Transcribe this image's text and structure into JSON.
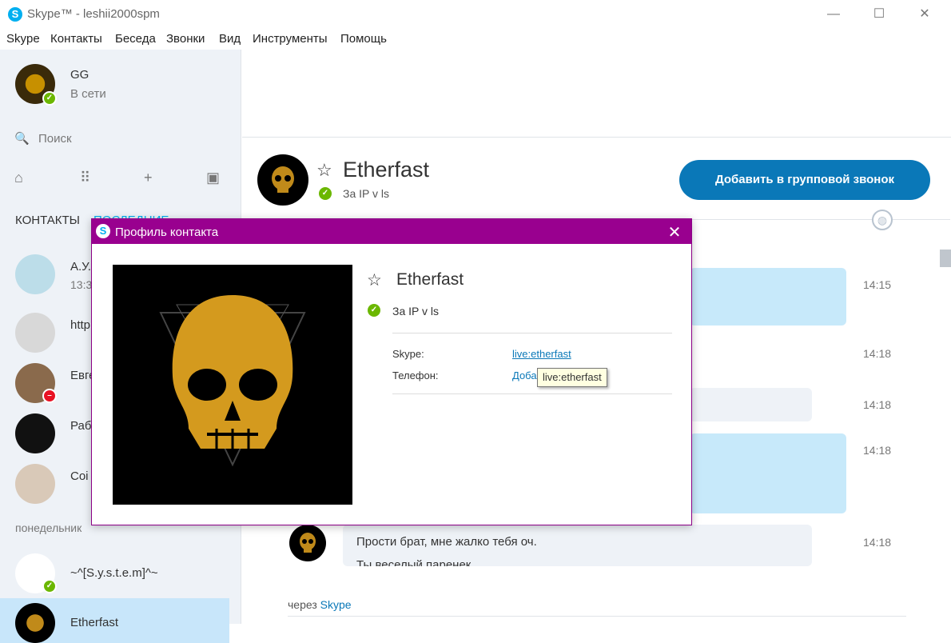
{
  "window": {
    "title": "Skype™ - leshii2000spm",
    "minimize": "—",
    "maximize": "☐",
    "close": "✕"
  },
  "menu": [
    "Skype",
    "Контакты",
    "Беседа",
    "Звонки",
    "Вид",
    "Инструменты",
    "Помощь"
  ],
  "me": {
    "name": "GG",
    "status": "В сети"
  },
  "search": {
    "placeholder": "Поиск"
  },
  "tabs": {
    "contacts": "КОНТАКТЫ",
    "recent": "ПОСЛЕДНИЕ"
  },
  "contacts": [
    {
      "name": "А.У.",
      "sub": "13:3"
    },
    {
      "name": "http",
      "sub": ""
    },
    {
      "name": "Евге",
      "sub": ""
    },
    {
      "name": "Раб",
      "sub": ""
    },
    {
      "name": "Coi",
      "sub": ""
    }
  ],
  "day_label": "понедельник",
  "contacts2": [
    {
      "name": "~^[S.y.s.t.e.m]^~"
    },
    {
      "name": "Etherfast"
    }
  ],
  "chat": {
    "name": "Etherfast",
    "status": "За IP v ls",
    "group_call_label": "Добавить в групповой звонок",
    "times": [
      "14:15",
      "14:18",
      "14:18",
      "14:18",
      "14:18"
    ],
    "last_message_line1": "Прости брат, мне жалко тебя оч.",
    "last_message_line2": "Ты веселый паренек",
    "via_prefix": "через",
    "via_link": "Skype"
  },
  "dialog": {
    "title": "Профиль контакта",
    "name": "Etherfast",
    "status": "За IP v ls",
    "skype_label": "Skype:",
    "skype_value": "live:etherfast",
    "phone_label": "Телефон:",
    "phone_value": "Доба",
    "tooltip": "live:etherfast"
  },
  "colors": {
    "accent": "#00aff0",
    "dialog_bar": "#99008f",
    "call_button": "#0a78b8",
    "online": "#6bb700"
  }
}
